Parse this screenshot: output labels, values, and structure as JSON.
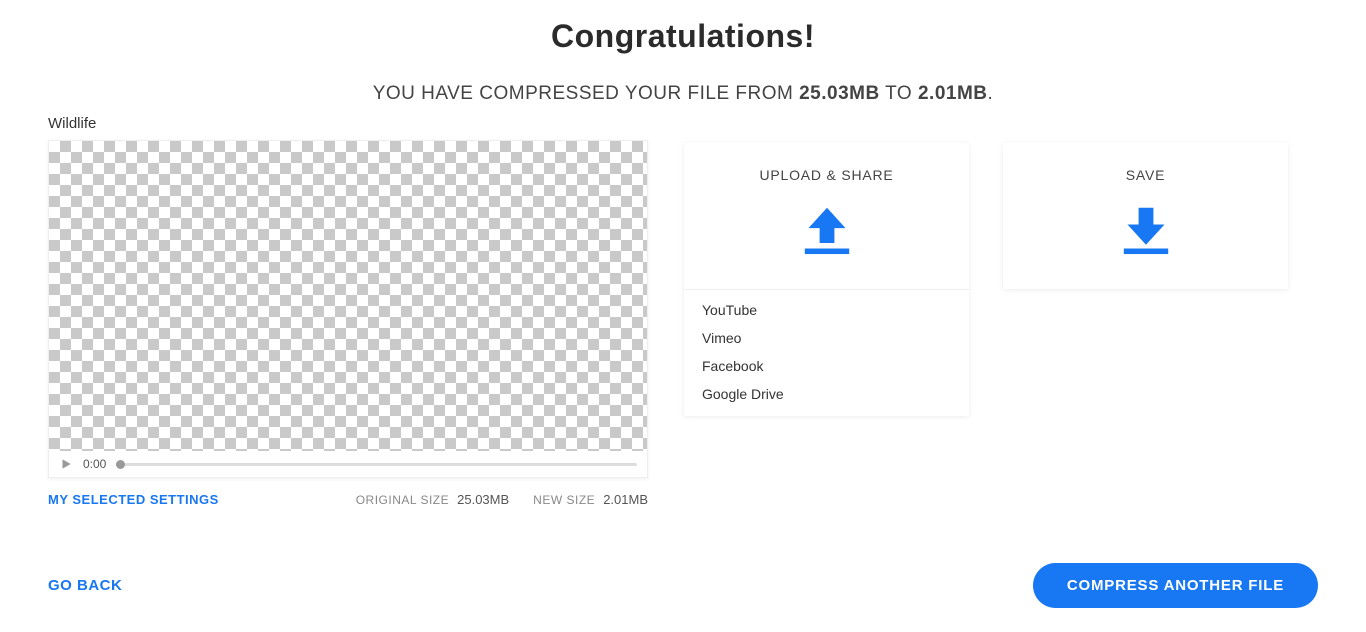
{
  "header": {
    "title": "Congratulations!",
    "subtitle_prefix": "YOU HAVE COMPRESSED YOUR FILE FROM ",
    "subtitle_mid": " TO ",
    "subtitle_suffix": ".",
    "original_size_inline": "25.03MB",
    "new_size_inline": "2.01MB"
  },
  "file": {
    "name": "Wildlife",
    "time": "0:00"
  },
  "info": {
    "settings_link": "MY SELECTED SETTINGS",
    "original_label": "ORIGINAL SIZE",
    "original_value": "25.03MB",
    "new_label": "NEW SIZE",
    "new_value": "2.01MB"
  },
  "upload_card": {
    "title": "UPLOAD & SHARE",
    "options": {
      "youtube": "YouTube",
      "vimeo": "Vimeo",
      "facebook": "Facebook",
      "gdrive": "Google Drive"
    }
  },
  "save_card": {
    "title": "SAVE"
  },
  "footer": {
    "go_back": "GO BACK",
    "compress_another": "COMPRESS ANOTHER FILE"
  }
}
